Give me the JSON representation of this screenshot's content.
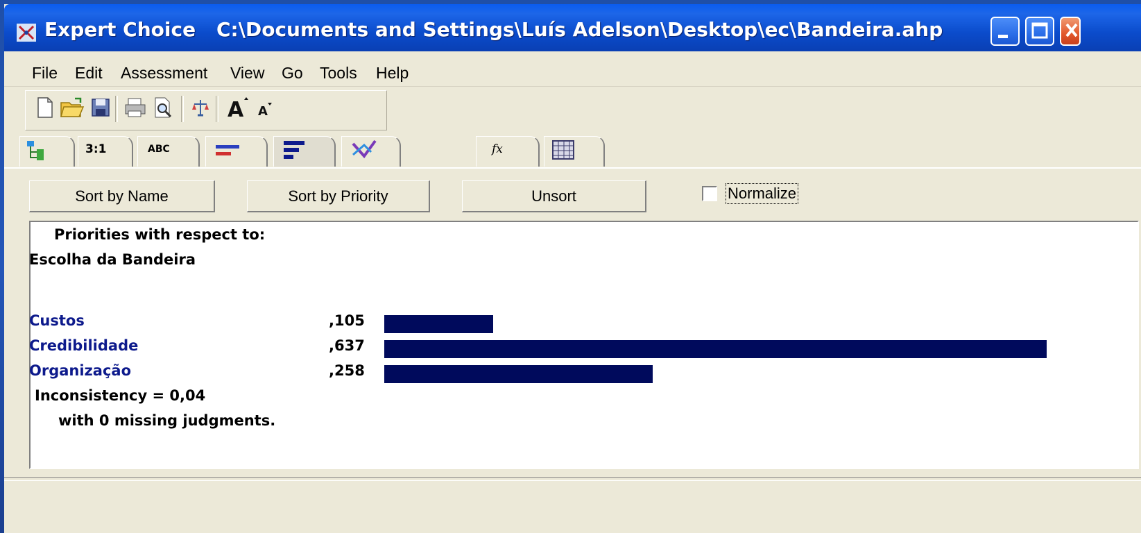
{
  "window": {
    "app_name": "Expert Choice",
    "file_path": "C:\\Documents and Settings\\Luís Adelson\\Desktop\\ec\\Bandeira.ahp"
  },
  "menu": [
    "File",
    "Edit",
    "Assessment",
    "View",
    "Go",
    "Tools",
    "Help"
  ],
  "tabs": [
    {
      "label": "",
      "icon": "tree-icon"
    },
    {
      "label": "3:1",
      "icon": ""
    },
    {
      "label": "ABC",
      "icon": ""
    },
    {
      "label": "",
      "icon": "bars-sort-icon"
    },
    {
      "label": "",
      "icon": "bars-priority-icon",
      "active": true
    },
    {
      "label": "",
      "icon": "sensitivity-icon"
    },
    {
      "label": "",
      "icon": "fx-icon"
    },
    {
      "label": "",
      "icon": "grid-icon"
    }
  ],
  "tab_fx_label": "fx",
  "buttons": {
    "sort_name": "Sort by Name",
    "sort_priority": "Sort by Priority",
    "unsort": "Unsort",
    "normalize": "Normalize"
  },
  "content": {
    "heading": "Priorities with respect to:",
    "goal": "Escolha da Bandeira",
    "items": [
      {
        "name": "Custos",
        "value_label": ",105",
        "value": 0.105
      },
      {
        "name": "Credibilidade",
        "value_label": ",637",
        "value": 0.637
      },
      {
        "name": "Organização",
        "value_label": ",258",
        "value": 0.258
      }
    ],
    "inconsistency": "Inconsistency = 0,04",
    "missing": "with 0  missing judgments."
  },
  "colors": {
    "bar": "#000a5c",
    "label_blue": "#0d1a8c"
  }
}
